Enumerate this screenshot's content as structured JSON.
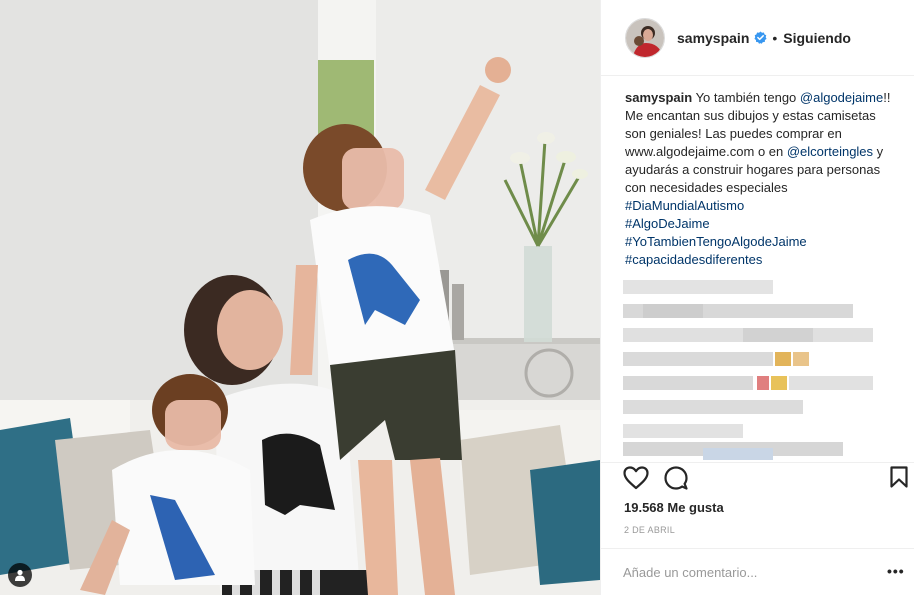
{
  "post": {
    "photo_description": "",
    "username": "samyspain",
    "follow_status": "Siguiendo",
    "separator": "•",
    "caption": {
      "user": "samyspain",
      "text_1": " Yo también tengo ",
      "mention_1": "@algodejaime",
      "text_2": "!! Me encantan sus dibujos y estas camisetas son geniales! Las puedes comprar en www.algodejaime.com o en ",
      "mention_2": "@elcorteingles",
      "text_3": " y ayudarás a construir hogares para personas con necesidades especiales ",
      "hashtag_1": "#DiaMundialAutismo",
      "hashtag_2": "#AlgoDeJaime",
      "hashtag_3": "#YoTambienTengoAlgodeJaime",
      "hashtag_4": "#capacidadesdiferentes"
    },
    "likes": "19.568 Me gusta",
    "date": "2 de abril",
    "comment_placeholder": "Añade un comentario...",
    "more_label": "•••"
  },
  "colors": {
    "link": "#003569",
    "verified": "#3897f0",
    "text": "#262626",
    "muted": "#999999",
    "border": "#efefef"
  },
  "icons": {
    "like": "heart-icon",
    "comment": "comment-bubble-icon",
    "save": "bookmark-icon",
    "verified": "verified-badge-icon",
    "user_tag": "person-tag-icon"
  }
}
